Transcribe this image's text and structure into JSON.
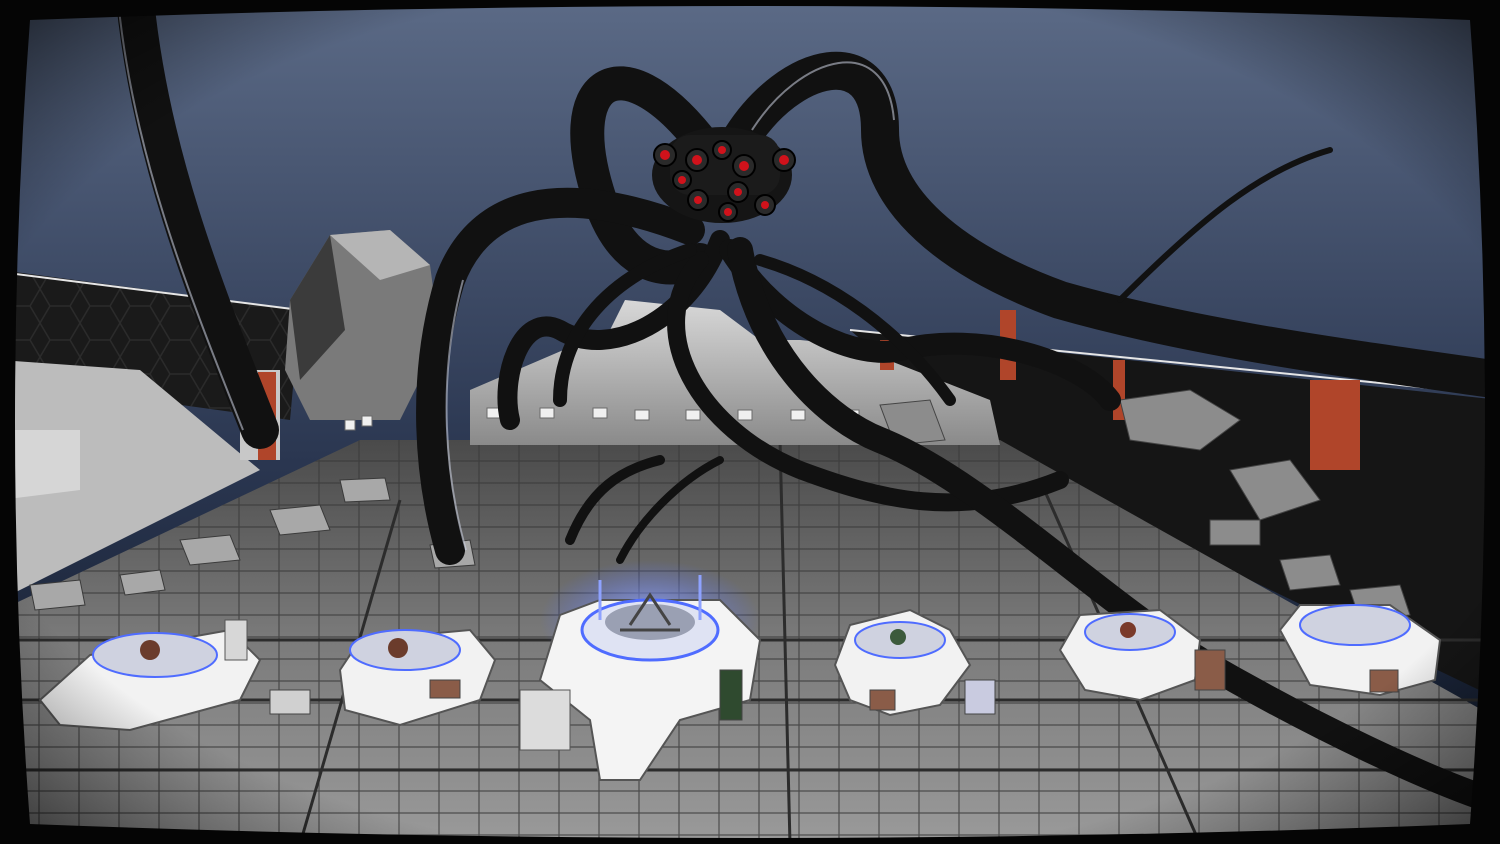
{
  "scene": {
    "kind": "3D game scene",
    "colors": {
      "sky_top": "#5b6a86",
      "sky_bottom": "#0d1524",
      "floor_light": "#9a9a9a",
      "floor_dark": "#4a4a4a",
      "creature": "#111111",
      "creature_eye": "#d0121b",
      "pod_body": "#f2f2f2",
      "pod_glow": "#4f6cff",
      "pillar_accent": "#b0452a",
      "rubble": "#9c9c9c",
      "vignette": "#000000"
    },
    "creature": {
      "name": "tentacled-creature",
      "eye_count": 10
    },
    "pods": [
      {
        "id": "pod-1",
        "highlighted": false
      },
      {
        "id": "pod-2",
        "highlighted": false
      },
      {
        "id": "pod-3",
        "highlighted": true
      },
      {
        "id": "pod-4",
        "highlighted": false
      },
      {
        "id": "pod-5",
        "highlighted": false
      },
      {
        "id": "pod-6",
        "highlighted": false
      }
    ]
  }
}
